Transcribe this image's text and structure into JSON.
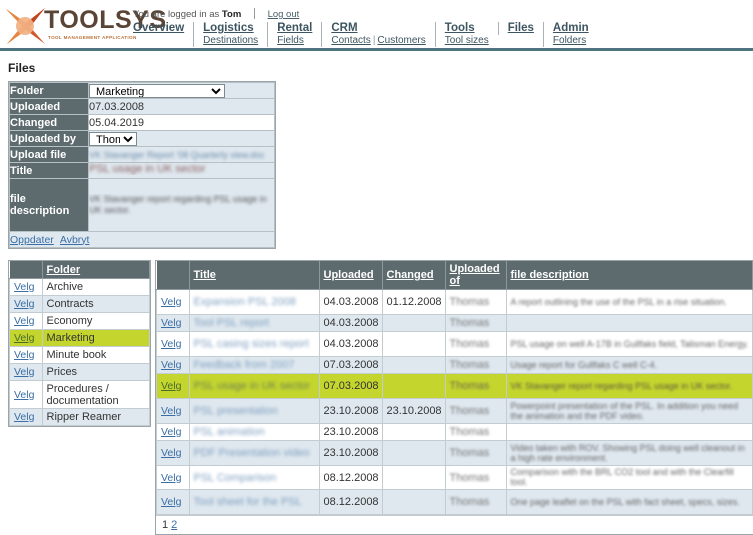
{
  "header": {
    "logo_text": "TOOLSYS",
    "logo_subtitle": "TOOL MANAGEMENT APPLICATION",
    "logged_in_prefix": "You are logged in as",
    "logged_in_user": "Tom",
    "logout_label": "Log out",
    "nav": [
      {
        "top": "Overview",
        "subs": []
      },
      {
        "top": "Logistics",
        "subs": [
          "Destinations"
        ]
      },
      {
        "top": "Rental",
        "subs": [
          "Fields"
        ]
      },
      {
        "top": "CRM",
        "subs": [
          "Contacts",
          "Customers"
        ]
      },
      {
        "top": "Tools",
        "subs": [
          "Tool sizes"
        ]
      },
      {
        "top": "Files",
        "subs": []
      },
      {
        "top": "Admin",
        "subs": [
          "Folders"
        ]
      }
    ]
  },
  "page": {
    "title": "Files"
  },
  "edit_form": {
    "labels": {
      "folder": "Folder",
      "uploaded": "Uploaded",
      "changed": "Changed",
      "uploaded_by": "Uploaded by",
      "upload_file": "Upload file",
      "title": "Title",
      "file_description": "file description"
    },
    "values": {
      "folder_selected": "Marketing",
      "folder_options": [
        "Marketing"
      ],
      "uploaded": "07.03.2008",
      "changed": "05.04.2019",
      "uploaded_by_selected": "Thomas",
      "upload_file": "VK Stavanger Report '08 Quarterly view.doc",
      "title": "PSL usage in UK sector",
      "file_description": "VK Stavanger report regarding PSL usage in UK sector."
    },
    "actions": {
      "update": "Oppdater",
      "cancel": "Avbryt"
    }
  },
  "folders_panel": {
    "select_label": "Velg",
    "header": "Folder",
    "rows": [
      {
        "name": "Archive",
        "selected": false
      },
      {
        "name": "Contracts",
        "selected": false
      },
      {
        "name": "Economy",
        "selected": false
      },
      {
        "name": "Marketing",
        "selected": true
      },
      {
        "name": "Minute book",
        "selected": false
      },
      {
        "name": "Prices",
        "selected": false
      },
      {
        "name": "Procedures / documentation",
        "selected": false
      },
      {
        "name": "Ripper Reamer",
        "selected": false
      }
    ]
  },
  "files_panel": {
    "select_label": "Velg",
    "headers": {
      "select": "",
      "title": "Title",
      "uploaded": "Uploaded",
      "changed": "Changed",
      "uploaded_of": "Uploaded of",
      "file_description": "file description"
    },
    "rows": [
      {
        "title": "Expansion PSL 2008",
        "uploaded": "04.03.2008",
        "changed": "01.12.2008",
        "uploaded_of": "Thomas",
        "description": "A report outlining the use of the PSL in a rise situation.",
        "selected": false
      },
      {
        "title": "Tool PSL report",
        "uploaded": "04.03.2008",
        "changed": "",
        "uploaded_of": "Thomas",
        "description": "",
        "selected": false
      },
      {
        "title": "PSL casing sizes report",
        "uploaded": "04.03.2008",
        "changed": "",
        "uploaded_of": "Thomas",
        "description": "PSL usage on well A-17B in Gullfaks field, Talisman Energy.",
        "selected": false
      },
      {
        "title": "Feedback from 2007",
        "uploaded": "07.03.2008",
        "changed": "",
        "uploaded_of": "Thomas",
        "description": "Usage report for Gullfaks C well C-4.",
        "selected": false
      },
      {
        "title": "PSL usage in UK sector",
        "uploaded": "07.03.2008",
        "changed": "",
        "uploaded_of": "Thomas",
        "description": "VK Stavanger report regarding PSL usage in UK sector.",
        "selected": true
      },
      {
        "title": "PSL presentation",
        "uploaded": "23.10.2008",
        "changed": "23.10.2008",
        "uploaded_of": "Thomas",
        "description": "Powerpoint presentation of the PSL. In addition you need the animation and the PDF video.",
        "selected": false
      },
      {
        "title": "PSL animation",
        "uploaded": "23.10.2008",
        "changed": "",
        "uploaded_of": "Thomas",
        "description": "",
        "selected": false
      },
      {
        "title": "PDF Presentation video",
        "uploaded": "23.10.2008",
        "changed": "",
        "uploaded_of": "Thomas",
        "description": "Video taken with ROV. Showing PSL doing well cleanout in a high rate environment.",
        "selected": false
      },
      {
        "title": "PSL Comparison",
        "uploaded": "08.12.2008",
        "changed": "",
        "uploaded_of": "Thomas",
        "description": "Comparison with the BRL CO2 tool and with the Clearfill tool.",
        "selected": false
      },
      {
        "title": "Tool sheet for the PSL",
        "uploaded": "08.12.2008",
        "changed": "",
        "uploaded_of": "Thomas",
        "description": "One page leaflet on the PSL with fact sheet, specs, sizes.",
        "selected": false
      }
    ],
    "pagination": {
      "current": "1",
      "pages": [
        "2"
      ]
    }
  },
  "colors": {
    "nav_rule": "#4f7480",
    "label_bg": "#5d6a6e",
    "row_alt_bg": "#dfe8ef",
    "row_selected_bg": "#c4d62e",
    "link": "#3a6ea5",
    "logo_brown": "#5a4436",
    "logo_orange": "#e2753a"
  }
}
